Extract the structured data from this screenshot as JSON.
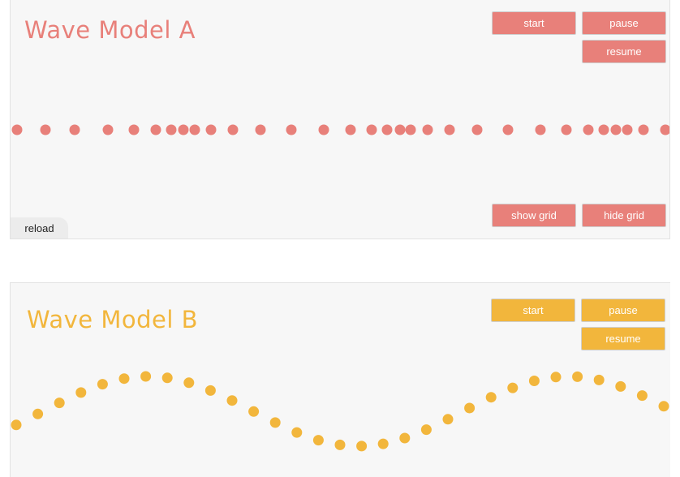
{
  "model_a": {
    "title": "Wave Model A",
    "buttons": {
      "start": "start",
      "pause": "pause",
      "resume": "resume",
      "show_grid": "show grid",
      "hide_grid": "hide grid"
    },
    "reload": "reload",
    "color": "#e8807a"
  },
  "model_b": {
    "title": "Wave Model B",
    "buttons": {
      "start": "start",
      "pause": "pause",
      "resume": "resume"
    },
    "color": "#f2b63c"
  }
}
